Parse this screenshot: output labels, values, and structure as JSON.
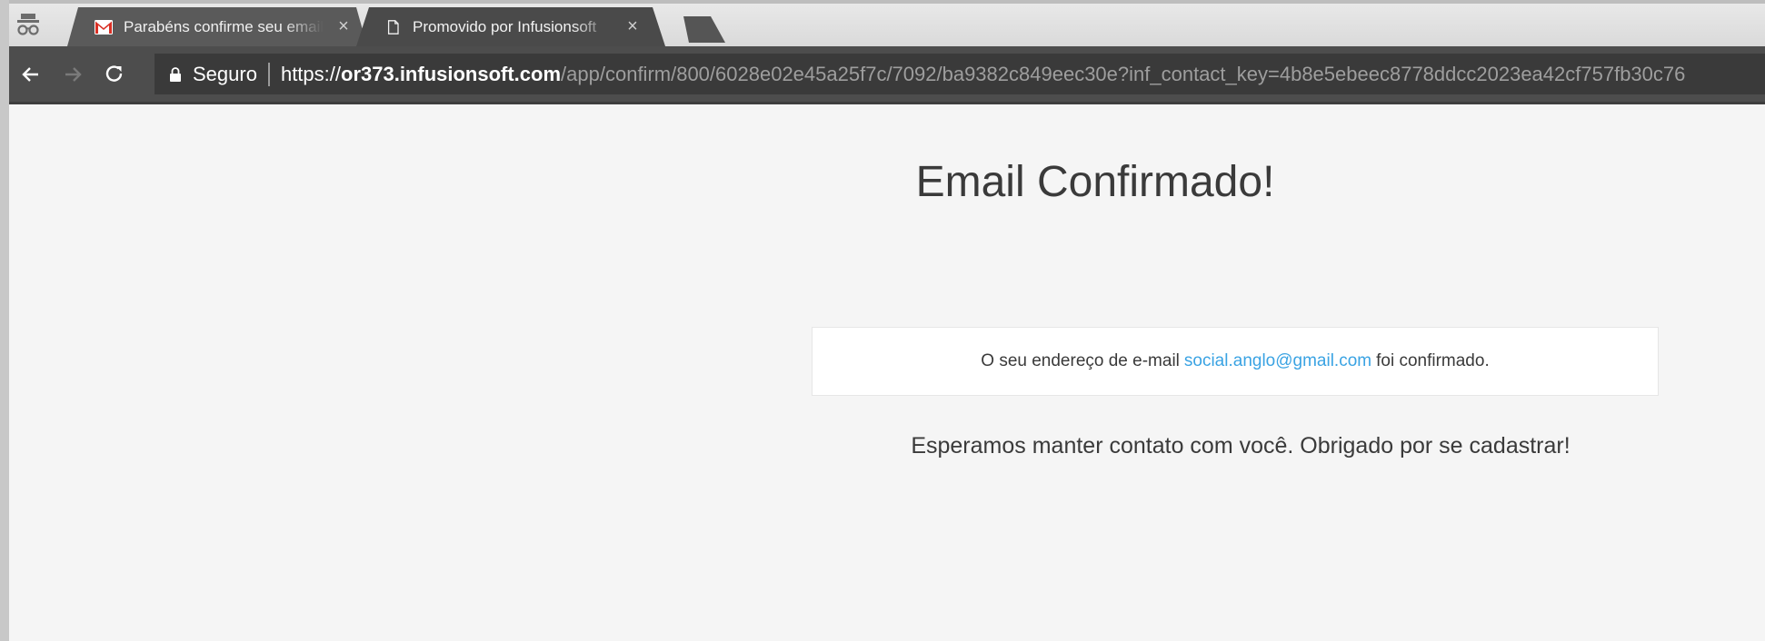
{
  "browser": {
    "tabs": [
      {
        "title": "Parabéns confirme seu email",
        "favicon": "gmail-icon",
        "active": false
      },
      {
        "title": "Promovido por Infusionsoft",
        "favicon": "page-icon",
        "active": true
      }
    ],
    "close_glyph": "×",
    "address_bar": {
      "secure_label": "Seguro",
      "scheme": "https://",
      "host": "or373.infusionsoft.com",
      "path": "/app/confirm/800/6028e02e45a25f7c/7092/ba9382c849eec30e?inf_contact_key=4b8e5ebeec8778ddcc2023ea42cf757fb30c76"
    },
    "colors": {
      "toolbar": "#4d4d4d",
      "gmail_red": "#d93025"
    }
  },
  "page": {
    "heading": "Email Confirmado!",
    "message_prefix": "O seu endereço de e-mail",
    "email": "social.anglo@gmail.com",
    "message_suffix": "foi confirmado.",
    "thanks": "Esperamos manter contato com você. Obrigado por se cadastrar!",
    "colors": {
      "link": "#3aa3e3",
      "text": "#3a3a3a"
    }
  }
}
